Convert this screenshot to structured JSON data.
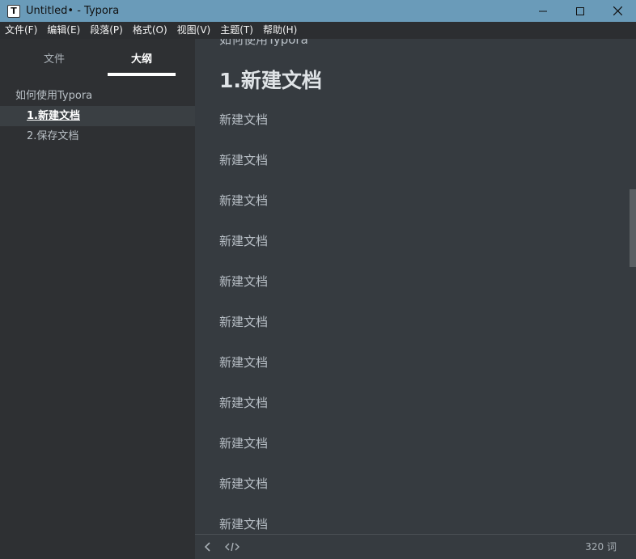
{
  "window": {
    "title": "Untitled• - Typora",
    "app_icon_letter": "T"
  },
  "menu": {
    "items": [
      "文件(F)",
      "编辑(E)",
      "段落(P)",
      "格式(O)",
      "视图(V)",
      "主题(T)",
      "帮助(H)"
    ]
  },
  "sidebar": {
    "tab_files": "文件",
    "tab_outline": "大纲",
    "outline": [
      {
        "label": "如何使用Typora",
        "level": 1,
        "active": false
      },
      {
        "label": "1.新建文档",
        "level": 2,
        "active": true
      },
      {
        "label": "2.保存文档",
        "level": 2,
        "active": false
      }
    ]
  },
  "editor": {
    "cutoff_text": "如何使用Typora",
    "heading": "1.新建文档",
    "paragraphs": [
      "新建文档",
      "新建文档",
      "新建文档",
      "新建文档",
      "新建文档",
      "新建文档",
      "新建文档",
      "新建文档",
      "新建文档",
      "新建文档",
      "新建文档"
    ]
  },
  "footer": {
    "word_count": "320 词"
  },
  "icons": {
    "back": "chevron-left-icon",
    "source": "code-icon",
    "minimize": "minimize-icon",
    "maximize": "maximize-icon",
    "close": "close-icon"
  }
}
